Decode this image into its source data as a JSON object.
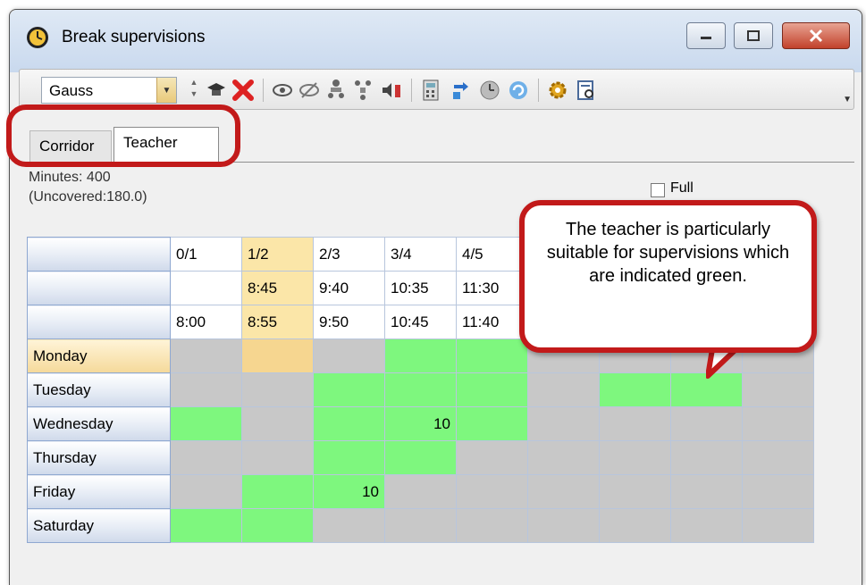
{
  "window": {
    "title": "Break supervisions",
    "min_glyph": "▭",
    "max_glyph": "▢",
    "close_glyph": "✕"
  },
  "toolbar": {
    "teacher_select": {
      "value": "Gauss"
    },
    "icons": [
      "mortarboard-icon",
      "delete-icon",
      "eye-icon",
      "eye-off-icon",
      "people-icon",
      "people-tree-icon",
      "speaker-icon",
      "calculator-icon",
      "swap-icon",
      "clock-icon",
      "refresh-icon",
      "gear-icon",
      "report-icon"
    ]
  },
  "tabs": [
    {
      "label": "Corridor",
      "active": false
    },
    {
      "label": "Teacher",
      "active": true
    }
  ],
  "info": {
    "minutes": "Minutes: 400",
    "uncovered": "(Uncovered:180.0)",
    "full_label": "Full"
  },
  "grid": {
    "periods": [
      "0/1",
      "1/2",
      "2/3",
      "3/4",
      "4/5",
      "",
      "",
      "",
      ""
    ],
    "start_times": [
      "",
      "8:45",
      "9:40",
      "10:35",
      "11:30",
      "",
      "",
      "",
      ""
    ],
    "end_times": [
      "8:00",
      "8:55",
      "9:50",
      "10:45",
      "11:40",
      "",
      "",
      "",
      ""
    ],
    "rows": [
      {
        "day": "Monday",
        "cells": [
          "x",
          "y",
          "x",
          "g",
          "g",
          "x",
          "x",
          "x",
          "x"
        ],
        "values": [
          "",
          "",
          "",
          "",
          "",
          "",
          "",
          "",
          ""
        ]
      },
      {
        "day": "Tuesday",
        "cells": [
          "x",
          "x",
          "g",
          "g",
          "g",
          "x",
          "g",
          "g",
          "x"
        ],
        "values": [
          "",
          "",
          "",
          "",
          "",
          "",
          "",
          "",
          ""
        ]
      },
      {
        "day": "Wednesday",
        "cells": [
          "g",
          "x",
          "g",
          "g",
          "g",
          "x",
          "x",
          "x",
          "x"
        ],
        "values": [
          "",
          "",
          "",
          "10",
          "",
          "",
          "",
          "",
          ""
        ]
      },
      {
        "day": "Thursday",
        "cells": [
          "x",
          "x",
          "g",
          "g",
          "x",
          "x",
          "x",
          "x",
          "x"
        ],
        "values": [
          "",
          "",
          "",
          "",
          "",
          "",
          "",
          "",
          ""
        ]
      },
      {
        "day": "Friday",
        "cells": [
          "x",
          "g",
          "g",
          "x",
          "x",
          "x",
          "x",
          "x",
          "x"
        ],
        "values": [
          "",
          "",
          "10",
          "",
          "",
          "",
          "",
          "",
          ""
        ]
      },
      {
        "day": "Saturday",
        "cells": [
          "g",
          "g",
          "x",
          "x",
          "x",
          "x",
          "x",
          "x",
          "x"
        ],
        "values": [
          "",
          "",
          "",
          "",
          "",
          "",
          "",
          "",
          ""
        ]
      }
    ]
  },
  "callout": {
    "text": "The teacher is particularly suitable for supervisions which are indicated green."
  },
  "colors": {
    "green": "#7ef77e",
    "gray": "#c8c8c8",
    "highlight": "#c21a1a",
    "selected": "#f6d690"
  }
}
